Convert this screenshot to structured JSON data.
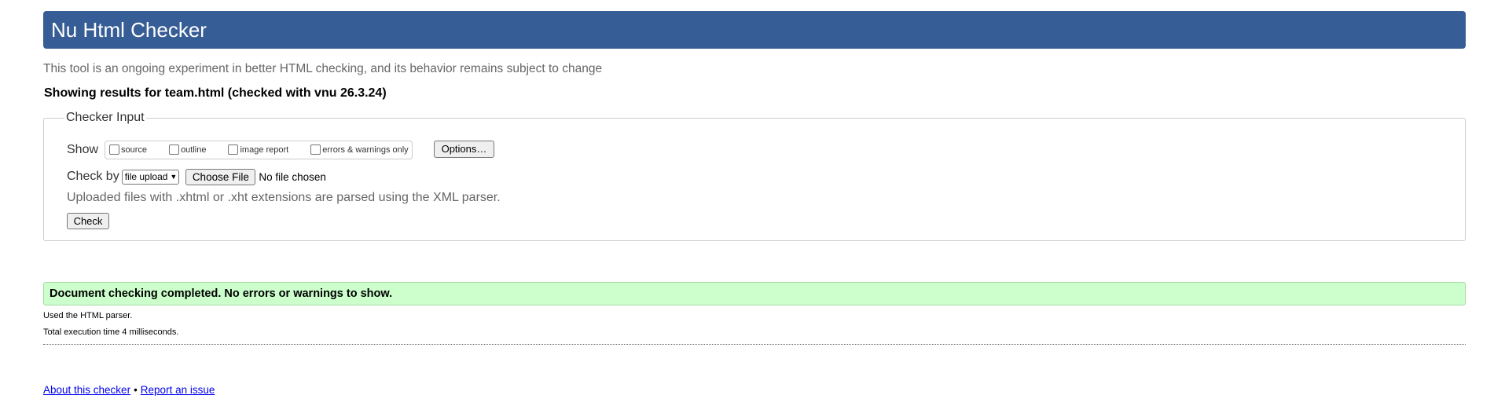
{
  "header": {
    "title": "Nu Html Checker"
  },
  "intro_text": "This tool is an ongoing experiment in better HTML checking, and its behavior remains subject to change",
  "results_heading": "Showing results for team.html (checked with vnu 26.3.24)",
  "checker_input": {
    "legend": "Checker Input",
    "show_label": "Show",
    "show_options": [
      {
        "label": "source",
        "checked": false
      },
      {
        "label": "outline",
        "checked": false
      },
      {
        "label": "image report",
        "checked": false
      },
      {
        "label": "errors & warnings only",
        "checked": false
      }
    ],
    "options_button": "Options…",
    "check_by_label": "Check by",
    "check_by_selected": "file upload",
    "choose_file_button": "Choose File",
    "no_file_text": "No file chosen",
    "upload_note": "Uploaded files with .xhtml or .xht extensions are parsed using the XML parser.",
    "check_button": "Check"
  },
  "result": {
    "success_message": "Document checking completed. No errors or warnings to show.",
    "parser_note": "Used the HTML parser.",
    "execution_time": "Total execution time 4 milliseconds."
  },
  "footer": {
    "about_link": "About this checker",
    "separator": "•",
    "report_link": "Report an issue"
  },
  "colors": {
    "header_bg": "#365d95",
    "success_bg": "#ccffcc",
    "link": "#0000ee"
  }
}
